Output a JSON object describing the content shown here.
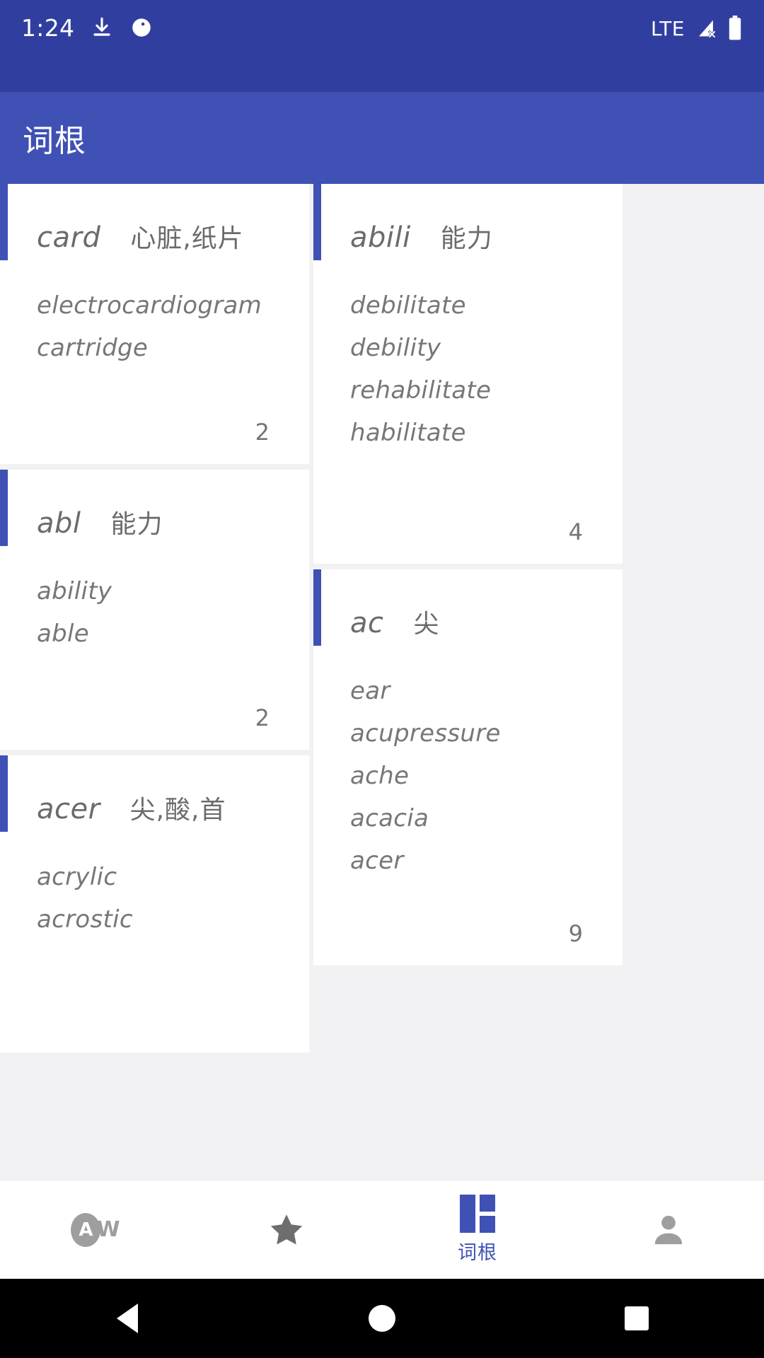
{
  "status_bar": {
    "clock": "1:24",
    "network": "LTE",
    "icons": [
      "download-icon",
      "moon-phase-icon",
      "signal-off-icon",
      "battery-icon"
    ]
  },
  "app_bar": {
    "title": "词根"
  },
  "columns": {
    "left": [
      {
        "root": "card",
        "meaning": "心脏,纸片",
        "words": [
          "electrocardiogram",
          "cartridge"
        ],
        "count": "2"
      },
      {
        "root": "abl",
        "meaning": "能力",
        "words": [
          "ability",
          "able"
        ],
        "count": "2"
      },
      {
        "root": "acer",
        "meaning": "尖,酸,首",
        "words": [
          "acrylic",
          "acrostic"
        ],
        "count": ""
      }
    ],
    "right": [
      {
        "root": "abili",
        "meaning": "能力",
        "words": [
          "debilitate",
          "debility",
          "rehabilitate",
          "habilitate"
        ],
        "count": "4"
      },
      {
        "root": "ac",
        "meaning": "尖",
        "words": [
          "ear",
          "acupressure",
          "ache",
          "acacia",
          "acer"
        ],
        "count": "9"
      }
    ]
  },
  "bottom_nav": {
    "items": [
      {
        "icon": "aw-logo-icon",
        "label": "",
        "selected": false
      },
      {
        "icon": "star-icon",
        "label": "",
        "selected": false
      },
      {
        "icon": "dashboard-grid-icon",
        "label": "词根",
        "selected": true
      },
      {
        "icon": "person-icon",
        "label": "",
        "selected": false
      }
    ]
  },
  "android_nav": {
    "back": "back-triangle-icon",
    "home": "home-circle-icon",
    "recents": "recents-square-icon"
  },
  "colors": {
    "status_bar": "#303F9F",
    "app_bar": "#3F51B5",
    "accent": "#3F51B5",
    "card_bg": "#FFFFFF",
    "page_bg": "#F2F2F4",
    "text_muted": "#777777"
  }
}
